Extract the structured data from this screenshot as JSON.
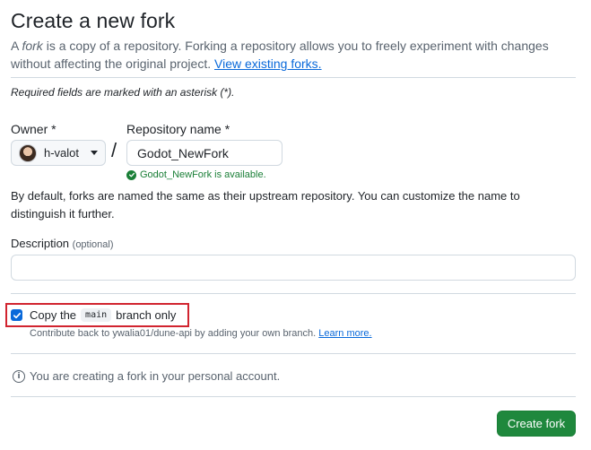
{
  "header": {
    "title": "Create a new fork",
    "subtitle_pre": "A ",
    "subtitle_em": "fork",
    "subtitle_post": " is a copy of a repository. Forking a repository allows you to freely experiment with changes without affecting the original project. ",
    "view_forks_link": "View existing forks."
  },
  "required_note": "Required fields are marked with an asterisk (*).",
  "owner": {
    "label": "Owner *",
    "value": "h-valot",
    "icon": "chevron-down-icon"
  },
  "separator": "/",
  "repository": {
    "label": "Repository name *",
    "value": "Godot_NewFork",
    "availability": "Godot_NewFork is available.",
    "availability_color": "#1a7f37"
  },
  "naming_help": "By default, forks are named the same as their upstream repository. You can customize the name to distinguish it further.",
  "description": {
    "label": "Description",
    "optional": "(optional)",
    "value": ""
  },
  "copy_branch": {
    "checked": true,
    "label_pre": "Copy the",
    "branch": "main",
    "label_post": "branch only",
    "help": "Contribute back to ywalia01/dune-api by adding your own branch.",
    "learn_more": "Learn more."
  },
  "info": "You are creating a fork in your personal account.",
  "create_button": "Create fork",
  "colors": {
    "accent": "#0969da",
    "primary_button": "#1f883d",
    "highlight_border": "#d1242f"
  }
}
